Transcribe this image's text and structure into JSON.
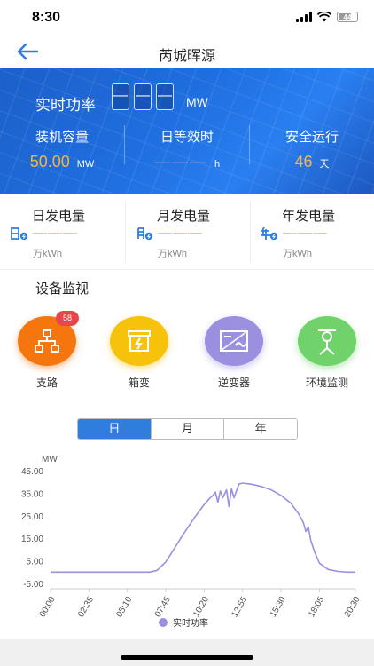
{
  "status_bar": {
    "time": "8:30",
    "battery": "44"
  },
  "nav": {
    "title": "芮城晖源"
  },
  "banner": {
    "realtime_label": "实时功率",
    "realtime_digits": [
      "—",
      "—",
      "—"
    ],
    "realtime_unit": "MW",
    "stats": [
      {
        "label": "装机容量",
        "value": "50.00",
        "unit": "MW"
      },
      {
        "label": "日等效时",
        "value": "———",
        "unit": "h"
      },
      {
        "label": "安全运行",
        "value": "46",
        "unit": "天"
      }
    ]
  },
  "energy": [
    {
      "label": "日发电量",
      "icon": "day-icon",
      "value": "———",
      "unit": "万kWh"
    },
    {
      "label": "月发电量",
      "icon": "month-icon",
      "value": "———",
      "unit": "万kWh"
    },
    {
      "label": "年发电量",
      "icon": "year-icon",
      "value": "———",
      "unit": "万kWh"
    }
  ],
  "devices": {
    "title": "设备监视",
    "items": [
      {
        "label": "支路",
        "badge": "58",
        "color": "#f5760f",
        "icon": "network-icon"
      },
      {
        "label": "箱变",
        "color": "#f7c20c",
        "icon": "box-transformer-icon"
      },
      {
        "label": "逆变器",
        "color": "#9b8fe0",
        "icon": "inverter-icon"
      },
      {
        "label": "环境监测",
        "color": "#6fd26a",
        "icon": "weather-station-icon"
      }
    ]
  },
  "tabs": [
    {
      "label": "日",
      "active": true
    },
    {
      "label": "月",
      "active": false
    },
    {
      "label": "年",
      "active": false
    }
  ],
  "chart_data": {
    "type": "line",
    "ylabel": "MW",
    "ylim": [
      -5,
      45
    ],
    "yticks": [
      "45.00",
      "35.00",
      "25.00",
      "15.00",
      "5.00",
      "-5.00"
    ],
    "xticks": [
      "00:00",
      "02:35",
      "05:10",
      "07:45",
      "10:20",
      "12:55",
      "15:30",
      "18:05",
      "20:30"
    ],
    "series": [
      {
        "name": "实时功率",
        "color": "#9b8fe0",
        "x": [
          "00:00",
          "02:35",
          "05:10",
          "06:40",
          "07:10",
          "07:45",
          "08:20",
          "09:00",
          "09:40",
          "10:20",
          "10:40",
          "10:55",
          "11:05",
          "11:15",
          "11:25",
          "11:35",
          "11:50",
          "12:00",
          "12:10",
          "12:20",
          "12:40",
          "12:55",
          "13:30",
          "14:10",
          "14:50",
          "15:30",
          "16:10",
          "16:40",
          "17:00",
          "17:10",
          "17:20",
          "17:30",
          "17:45",
          "18:05",
          "18:40",
          "19:20",
          "20:00",
          "20:30"
        ],
        "y": [
          0,
          0,
          0,
          0,
          0.8,
          4.5,
          10.5,
          17.5,
          24,
          30,
          32.5,
          34,
          35.5,
          31,
          36,
          33,
          36.5,
          29,
          37,
          33,
          39,
          39.5,
          39,
          38,
          36.5,
          34,
          30.5,
          26,
          22,
          18,
          20,
          14,
          9,
          4,
          1.2,
          0.3,
          0,
          0
        ]
      }
    ]
  }
}
